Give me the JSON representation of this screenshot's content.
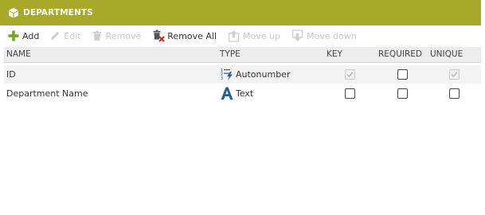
{
  "header": {
    "title": "DEPARTMENTS",
    "background": "#a8a82a"
  },
  "toolbar": {
    "add": "Add",
    "edit": "Edit",
    "remove": "Remove",
    "remove_all": "Remove All",
    "move_up": "Move up",
    "move_down": "Move down"
  },
  "columns": {
    "name": "NAME",
    "type": "TYPE",
    "key": "KEY",
    "required": "REQUIRED",
    "unique": "UNIQUE"
  },
  "rows": [
    {
      "name": "ID",
      "type": "Autonumber",
      "type_icon": "autonumber-icon",
      "key": true,
      "key_enabled": false,
      "required": false,
      "unique": true,
      "unique_enabled": false
    },
    {
      "name": "Department Name",
      "type": "Text",
      "type_icon": "text-type-icon",
      "key": false,
      "key_enabled": true,
      "required": false,
      "unique": false,
      "unique_enabled": true
    }
  ],
  "colors": {
    "accent_green": "#6a9a1e",
    "remove_red": "#cc2222",
    "type_blue": "#2b5b8a"
  }
}
